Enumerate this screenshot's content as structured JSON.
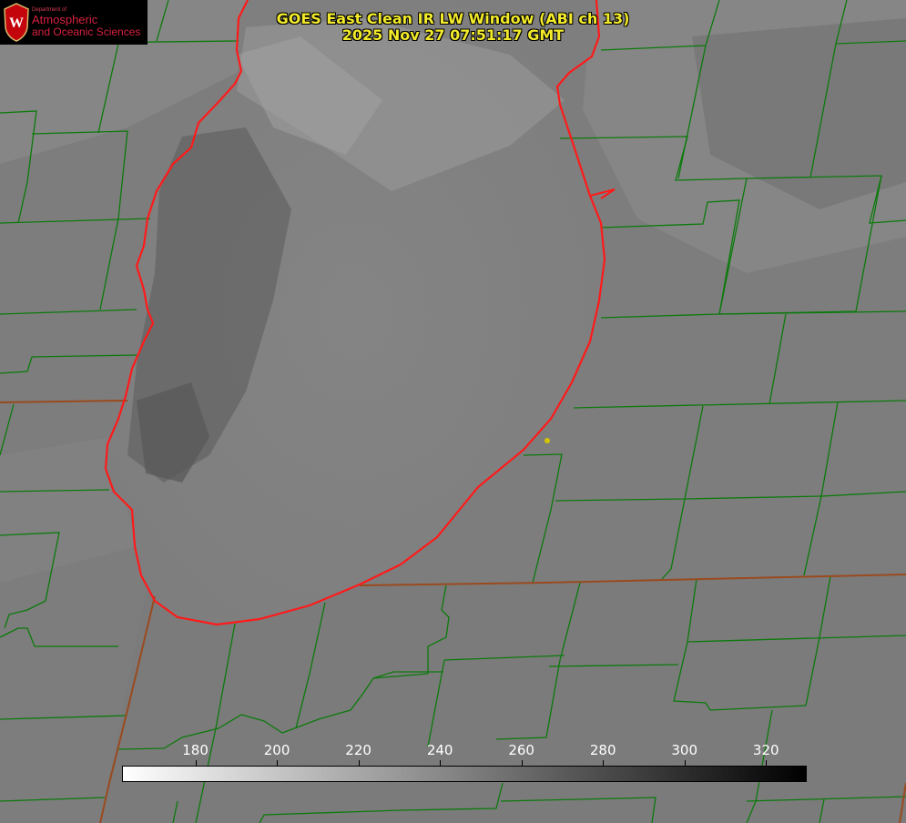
{
  "title_line1": "GOES East Clean IR LW Window (ABI ch 13)",
  "title_line2": "2025 Nov 27 07:51:17 GMT",
  "logo": {
    "department": "Department of",
    "line1": "Atmospheric",
    "line2": "and Oceanic Sciences",
    "crest_letter": "W",
    "color": "#c5050c"
  },
  "colorbar": {
    "ticks": [
      "180",
      "200",
      "220",
      "240",
      "260",
      "280",
      "300",
      "320"
    ],
    "min": 162,
    "max": 330,
    "low_color": "#ffffff",
    "high_color": "#000000"
  },
  "colors": {
    "title": "#f2ea2a",
    "county_borders": "#0c7a0c",
    "state_borders": "#9a4a1e",
    "lake_shoreline": "#ff1a1a",
    "station_marker": "#d4c400",
    "background": "#7c7c7c"
  }
}
